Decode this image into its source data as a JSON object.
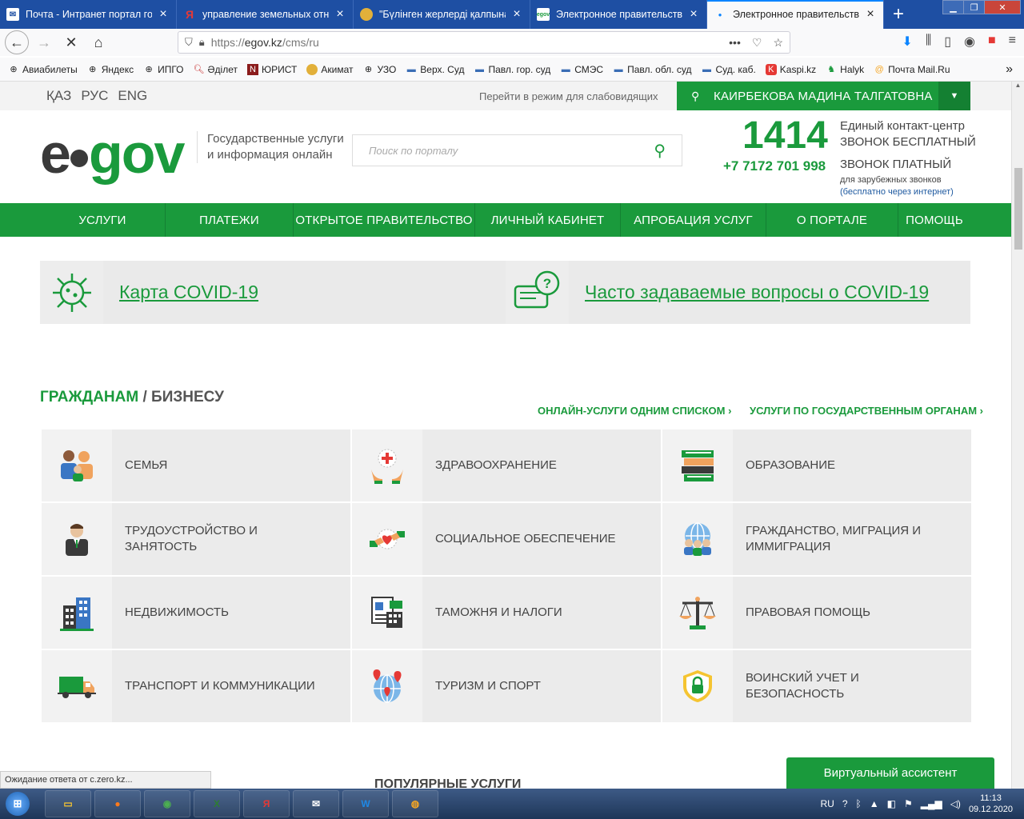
{
  "browser": {
    "tabs": [
      {
        "title": "Почта - Интранет портал гос",
        "active": false
      },
      {
        "title": "управление земельных отно",
        "active": false
      },
      {
        "title": "\"Бүлінген жерлерді қалпына",
        "active": false
      },
      {
        "title": "Электронное правительство",
        "active": false
      },
      {
        "title": "Электронное правительство",
        "active": true
      }
    ],
    "url_scheme": "https://",
    "url_host": "egov.kz",
    "url_path": "/cms/ru",
    "bookmarks": [
      "Авиабилеты",
      "Яндекс",
      "ИПГО",
      "Әділет",
      "ЮРИСТ",
      "Акимат",
      "УЗО",
      "Верх. Суд",
      "Павл. гор. суд",
      "СМЭС",
      "Павл. обл. суд",
      "Суд. каб.",
      "Kaspi.kz",
      "Halyk",
      "Почта Mail.Ru"
    ]
  },
  "site": {
    "languages": [
      "ҚАЗ",
      "РУС",
      "ENG"
    ],
    "accessibility_link": "Перейти в режим для слабовидящих",
    "user_name": "КАИРБЕКОВА МАДИНА ТАЛГАТОВНА",
    "logo_e": "e",
    "logo_gov": "gov",
    "tagline_1": "Государственные услуги",
    "tagline_2": "и информация онлайн",
    "search_placeholder": "Поиск по порталу",
    "contact_number": "1414",
    "contact_title": "Единый контакт-центр",
    "contact_free": "ЗВОНОК БЕСПЛАТНЫЙ",
    "contact_phone": "+7 7172 701 998",
    "contact_paid": "ЗВОНОК ПЛАТНЫЙ",
    "contact_foreign": "для зарубежных звонков",
    "contact_internet": "(бесплатно через интернет)",
    "nav": [
      "УСЛУГИ",
      "ПЛАТЕЖИ",
      "ОТКРЫТОЕ ПРАВИТЕЛЬСТВО",
      "ЛИЧНЫЙ КАБИНЕТ",
      "АПРОБАЦИЯ УСЛУГ",
      "О ПОРТАЛЕ",
      "ПОМОЩЬ"
    ],
    "covid_map": "Карта COVID-19",
    "covid_faq": "Часто задаваемые вопросы о COVID-19",
    "section_citizens": "ГРАЖДАНАМ",
    "section_slash": " / ",
    "section_business": "БИЗНЕСУ",
    "link_online_list": "ОНЛАЙН-УСЛУГИ ОДНИМ СПИСКОМ ›",
    "link_by_agency": "УСЛУГИ ПО ГОСУДАРСТВЕННЫМ ОРГАНАМ ›",
    "categories": [
      {
        "label": "СЕМЬЯ",
        "icon": "family-icon"
      },
      {
        "label": "ЗДРАВООХРАНЕНИЕ",
        "icon": "healthcare-icon"
      },
      {
        "label": "ОБРАЗОВАНИЕ",
        "icon": "education-icon"
      },
      {
        "label": "ТРУДОУСТРОЙСТВО И ЗАНЯТОСТЬ",
        "icon": "employment-icon"
      },
      {
        "label": "СОЦИАЛЬНОЕ ОБЕСПЕЧЕНИЕ",
        "icon": "social-security-icon"
      },
      {
        "label": "ГРАЖДАНСТВО, МИГРАЦИЯ И ИММИГРАЦИЯ",
        "icon": "citizenship-icon"
      },
      {
        "label": "НЕДВИЖИМОСТЬ",
        "icon": "real-estate-icon"
      },
      {
        "label": "ТАМОЖНЯ И НАЛОГИ",
        "icon": "customs-taxes-icon"
      },
      {
        "label": "ПРАВОВАЯ ПОМОЩЬ",
        "icon": "legal-aid-icon"
      },
      {
        "label": "ТРАНСПОРТ И КОММУНИКАЦИИ",
        "icon": "transport-icon"
      },
      {
        "label": "ТУРИЗМ И СПОРТ",
        "icon": "tourism-icon"
      },
      {
        "label": "ВОИНСКИЙ УЧЕТ И БЕЗОПАСНОСТЬ",
        "icon": "military-security-icon"
      }
    ],
    "virtual_assistant": "Виртуальный ассистент",
    "popular_services": "ПОПУЛЯРНЫЕ УСЛУГИ"
  },
  "status_text": "Ожидание ответа от c.zero.kz...",
  "taskbar": {
    "lang": "RU",
    "time": "11:13",
    "date": "09.12.2020"
  },
  "colors": {
    "brand_green": "#1a9a3c",
    "tab_blue": "#1e4fa3"
  }
}
